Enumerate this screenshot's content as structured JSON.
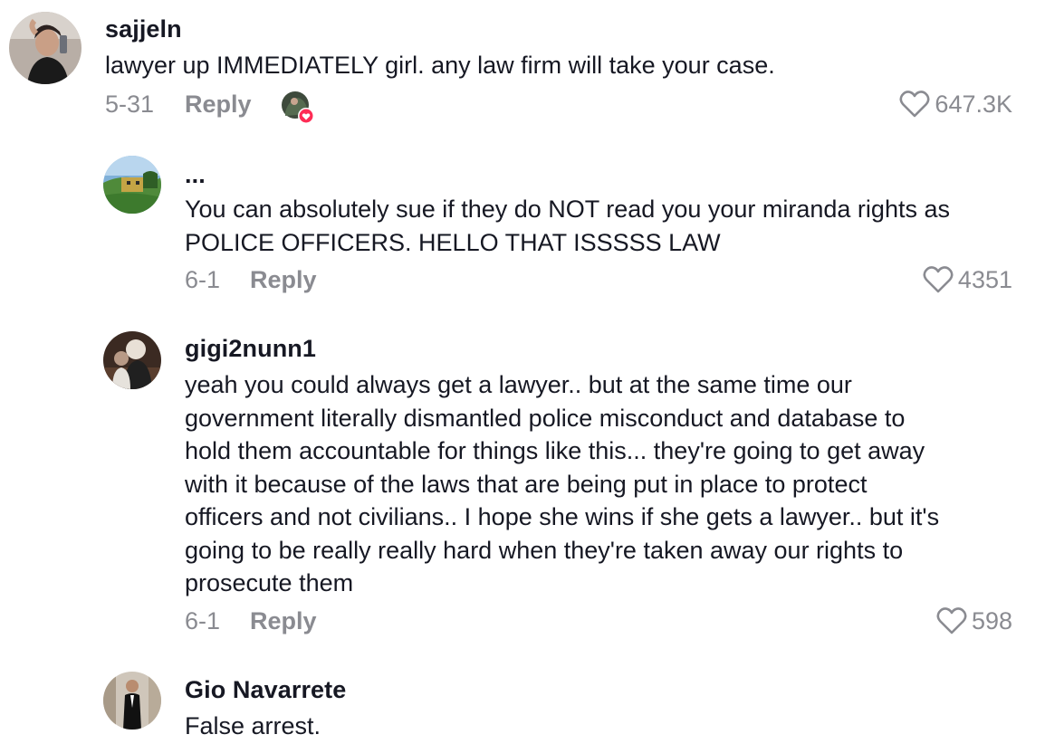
{
  "comments": [
    {
      "username": "sajjeln",
      "text": "lawyer up IMMEDIATELY girl. any law firm will take your case.",
      "date": "5-31",
      "reply_label": "Reply",
      "likes": "647.3K",
      "creator_liked": true
    },
    {
      "username": "...",
      "text": "You can absolutely sue if they do NOT read you your miranda rights as\nPOLICE OFFICERS. HELLO THAT ISSSSS LAW",
      "date": "6-1",
      "reply_label": "Reply",
      "likes": "4351"
    },
    {
      "username": "gigi2nunn1",
      "text": "yeah you could always get a lawyer.. but at the same time our\ngovernment literally dismantled police misconduct and database to\nhold them accountable for things like this... they're going to get away\nwith it because of the laws that are being put in place to protect\nofficers and not civilians.. I hope she wins if she gets a lawyer.. but it's\ngoing to be really really hard when they're taken away our rights to\nprosecute them",
      "date": "6-1",
      "reply_label": "Reply",
      "likes": "598"
    },
    {
      "username": "Gio Navarrete",
      "text": "False arrest."
    }
  ],
  "colors": {
    "text": "#161823",
    "muted": "#8a8b91",
    "like_badge": "#fe2c55"
  }
}
